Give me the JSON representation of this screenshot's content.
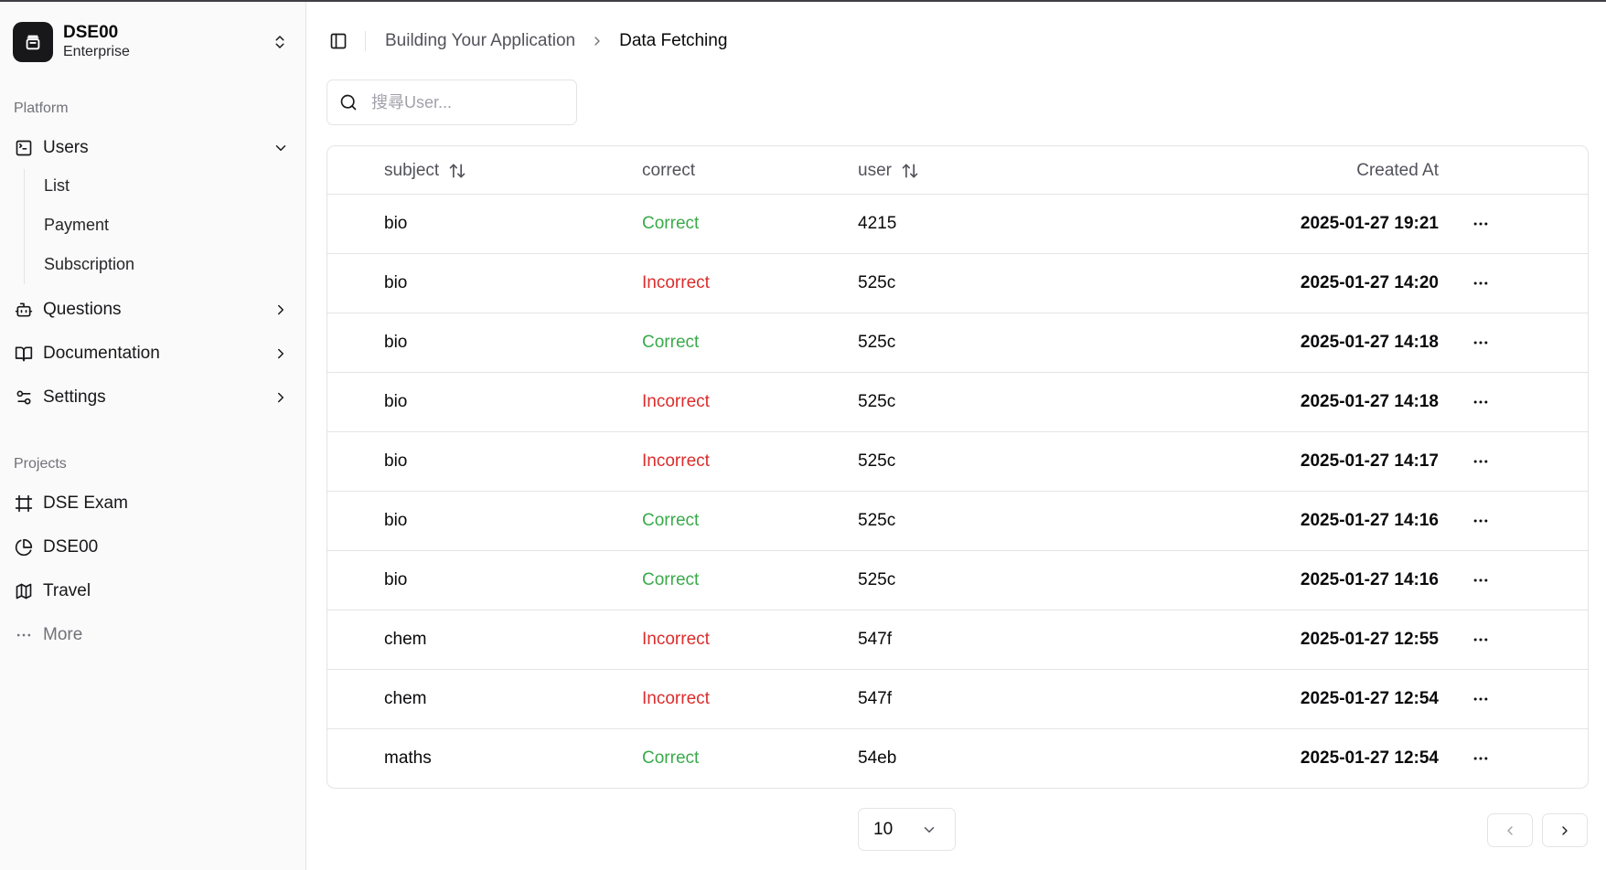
{
  "team": {
    "name": "DSE00",
    "plan": "Enterprise"
  },
  "sidebar": {
    "platform_label": "Platform",
    "nav": [
      {
        "label": "Users",
        "icon": "square-terminal-icon",
        "expanded": true
      },
      {
        "label": "Questions",
        "icon": "bot-icon"
      },
      {
        "label": "Documentation",
        "icon": "book-open-icon"
      },
      {
        "label": "Settings",
        "icon": "settings-icon"
      }
    ],
    "users_sub": [
      "List",
      "Payment",
      "Subscription"
    ],
    "projects_label": "Projects",
    "projects": [
      {
        "label": "DSE Exam",
        "icon": "frame-icon"
      },
      {
        "label": "DSE00",
        "icon": "pie-chart-icon"
      },
      {
        "label": "Travel",
        "icon": "map-icon"
      }
    ],
    "more_label": "More"
  },
  "breadcrumb": {
    "parent": "Building Your Application",
    "current": "Data Fetching"
  },
  "search": {
    "placeholder": "搜尋User...",
    "value": ""
  },
  "table": {
    "columns": {
      "subject": "subject",
      "correct": "correct",
      "user": "user",
      "created_at": "Created At"
    },
    "rows": [
      {
        "subject": "bio",
        "correct": "Correct",
        "user": "4215",
        "created_at": "2025-01-27 19:21"
      },
      {
        "subject": "bio",
        "correct": "Incorrect",
        "user": "525c",
        "created_at": "2025-01-27 14:20"
      },
      {
        "subject": "bio",
        "correct": "Correct",
        "user": "525c",
        "created_at": "2025-01-27 14:18"
      },
      {
        "subject": "bio",
        "correct": "Incorrect",
        "user": "525c",
        "created_at": "2025-01-27 14:18"
      },
      {
        "subject": "bio",
        "correct": "Incorrect",
        "user": "525c",
        "created_at": "2025-01-27 14:17"
      },
      {
        "subject": "bio",
        "correct": "Correct",
        "user": "525c",
        "created_at": "2025-01-27 14:16"
      },
      {
        "subject": "bio",
        "correct": "Correct",
        "user": "525c",
        "created_at": "2025-01-27 14:16"
      },
      {
        "subject": "chem",
        "correct": "Incorrect",
        "user": "547f",
        "created_at": "2025-01-27 12:55"
      },
      {
        "subject": "chem",
        "correct": "Incorrect",
        "user": "547f",
        "created_at": "2025-01-27 12:54"
      },
      {
        "subject": "maths",
        "correct": "Correct",
        "user": "54eb",
        "created_at": "2025-01-27 12:54"
      }
    ]
  },
  "pagination": {
    "page_size": "10"
  },
  "colors": {
    "correct": "#3aaa4a",
    "incorrect": "#dc2c2c",
    "sidebar_bg": "#fafafa",
    "border": "#e4e4e7"
  }
}
